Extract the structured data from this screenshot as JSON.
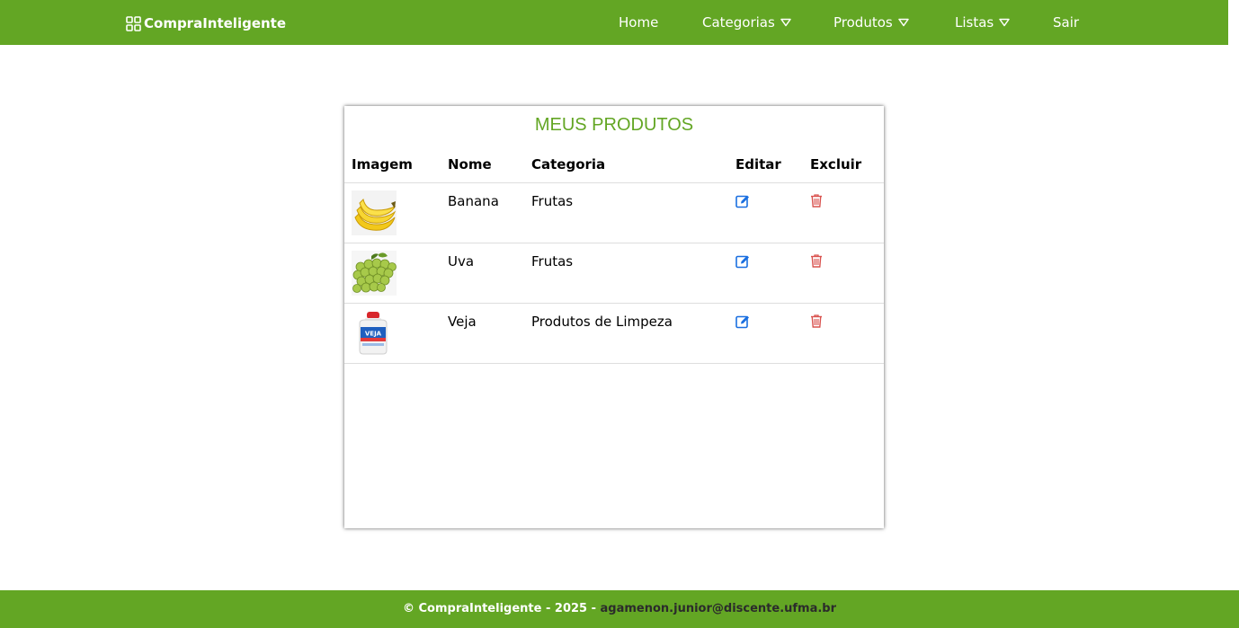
{
  "header": {
    "brand": "CompraInteligente",
    "nav": [
      {
        "label": "Home"
      },
      {
        "label": "Categorias"
      },
      {
        "label": "Produtos"
      },
      {
        "label": "Listas"
      },
      {
        "label": "Sair"
      }
    ]
  },
  "main": {
    "title": "MEUS PRODUTOS",
    "columns": [
      "Imagem",
      "Nome",
      "Categoria",
      "Editar",
      "Excluir"
    ],
    "rows": [
      {
        "nome": "Banana",
        "categoria": "Frutas",
        "image_icon": "banana-image"
      },
      {
        "nome": "Uva",
        "categoria": "Frutas",
        "image_icon": "grapes-image"
      },
      {
        "nome": "Veja",
        "categoria": "Produtos de Limpeza",
        "image_icon": "cleaning-bottle-image"
      }
    ]
  },
  "footer": {
    "text": "© CompraInteligente - 2025 - ",
    "email": "agamenon.junior@discente.ufma.br"
  },
  "colors": {
    "brand_green": "#63a624",
    "edit_blue": "#1a6fe0",
    "delete_red": "#d9534f"
  }
}
